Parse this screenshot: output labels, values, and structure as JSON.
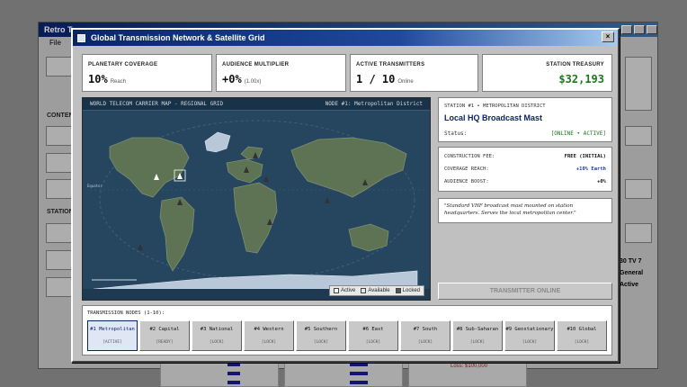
{
  "background_app": {
    "title": "Retro T",
    "menu_file": "File",
    "content_label": "CONTEN",
    "station_label": "STATION",
    "side_line1": "30 TV 7",
    "side_line2": "General",
    "side_line3": "Active",
    "loss_text": "Loss: $100,000"
  },
  "dialog": {
    "title": "Global Transmission Network & Satellite Grid",
    "close_glyph": "×"
  },
  "stats": {
    "coverage_label": "PLANETARY COVERAGE",
    "coverage_value": "10%",
    "coverage_sub": "Reach",
    "multiplier_label": "AUDIENCE MULTIPLIER",
    "multiplier_value": "+0%",
    "multiplier_sub": "(1.00x)",
    "transmitters_label": "ACTIVE TRANSMITTERS",
    "transmitters_value": "1 / 10",
    "transmitters_sub": "Online",
    "treasury_label": "STATION TREASURY",
    "treasury_value": "$32,193"
  },
  "map": {
    "title": "WORLD TELECOM CARRIER MAP - REGIONAL GRID",
    "node_label": "NODE #1: Metropolitan District",
    "equator_label": "Equator",
    "legend_active": "Active",
    "legend_available": "Available",
    "legend_locked": "Locked",
    "colors": {
      "ocean": "#264660",
      "land": "#5e7254",
      "ice": "#b8c8d8",
      "active": "#ffffff",
      "locked": "#444444"
    }
  },
  "station_info": {
    "kicker": "STATION #1 • METROPOLITAN DISTRICT",
    "title": "Local HQ Broadcast Mast",
    "status_label": "Status:",
    "status_value": "[ONLINE • ACTIVE]"
  },
  "costs": {
    "fee_label": "CONSTRUCTION FEE:",
    "fee_value": "FREE (INITIAL)",
    "reach_label": "COVERAGE REACH:",
    "reach_value": "+10% Earth",
    "boost_label": "AUDIENCE BOOST:",
    "boost_value": "+0%"
  },
  "quote": "\"Standard VHF broadcast mast mounted on station headquarters. Serves the local metropolitan center.\"",
  "online_button": "TRANSMITTER ONLINE",
  "nodes": {
    "label": "TRANSMISSION NODES (1-10):",
    "items": [
      {
        "name": "#1 Metropolitan",
        "state": "[ACTIVE]"
      },
      {
        "name": "#2 Capital",
        "state": "[READY]"
      },
      {
        "name": "#3 National",
        "state": "[LOCK]"
      },
      {
        "name": "#4 Western",
        "state": "[LOCK]"
      },
      {
        "name": "#5 Southern",
        "state": "[LOCK]"
      },
      {
        "name": "#6 East",
        "state": "[LOCK]"
      },
      {
        "name": "#7 South",
        "state": "[LOCK]"
      },
      {
        "name": "#8 Sub-Saharan",
        "state": "[LOCK]"
      },
      {
        "name": "#9 Geostationary",
        "state": "[LOCK]"
      },
      {
        "name": "#10 Global",
        "state": "[LOCK]"
      }
    ]
  }
}
